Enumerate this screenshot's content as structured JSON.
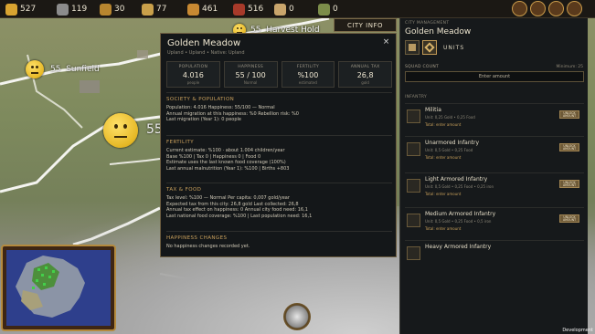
{
  "topbar": {
    "resources": [
      {
        "icon": "gold-coins-icon",
        "value": "527",
        "color": "#d9a431"
      },
      {
        "icon": "iron-ingot-icon",
        "value": "119",
        "color": "#8c8c8c"
      },
      {
        "icon": "food-crate-icon",
        "value": "30",
        "color": "#b8862f"
      },
      {
        "icon": "lumber-icon",
        "value": "77",
        "color": "#c9a04a"
      },
      {
        "icon": "bread-icon",
        "value": "461",
        "color": "#c88932"
      },
      {
        "icon": "wine-icon",
        "value": "516",
        "color": "#a83a2a"
      },
      {
        "icon": "horse-icon",
        "value": "0",
        "color": "#c9a56c"
      },
      {
        "icon": "map-scroll-icon",
        "value": "0",
        "color": "#7c8d4a"
      }
    ]
  },
  "map": {
    "cities": [
      {
        "count": "55",
        "name": "Harvest Hold"
      },
      {
        "count": "55",
        "name": "Sunfield"
      },
      {
        "count": "55",
        "name": ""
      }
    ]
  },
  "city_info_button": "CITY INFO",
  "panel": {
    "title": "Golden Meadow",
    "subtitle": "Upland • Upland • Native: Upland",
    "close": "×",
    "stats": [
      {
        "key": "POPULATION",
        "value": "4.016",
        "note": "people"
      },
      {
        "key": "HAPPINESS",
        "value": "55 / 100",
        "note": "Normal"
      },
      {
        "key": "FERTILITY",
        "value": "%100",
        "note": "estimated"
      },
      {
        "key": "ANNUAL TAX",
        "value": "26,8",
        "note": "gold"
      }
    ],
    "sections": [
      {
        "title": "SOCIETY & POPULATION",
        "lines": [
          "Population: 4.016   Happiness: 55/100 — Normal",
          "Annual migration at this happiness: %0   Rebellion risk: %0",
          "Last migration (Year 1): 0 people"
        ]
      },
      {
        "title": "FERTILITY",
        "lines": [
          "Current estimate: %100  ·  about 1.004 children/year",
          "Base %100  |  Tax 0  |  Happiness 0  |  Food 0",
          "Estimate uses the last known food coverage (100%)",
          "Last annual malnutrition (Year 1): %100  |  Births +803"
        ]
      },
      {
        "title": "TAX & FOOD",
        "lines": [
          "Tax level: %100 — Normal   Per capita: 0,007 gold/year",
          "Expected tax from this city: 26,8 gold   Last collected: 26,8",
          "Annual tax effect on happiness: 0   Annual city food need: 16,1",
          "Last national food coverage: %100  |  Last population need: 16,1"
        ]
      },
      {
        "title": "HAPPINESS CHANGES",
        "lines": [
          "No happiness changes recorded yet."
        ]
      }
    ]
  },
  "right_panel": {
    "heading": "CITY MANAGEMENT",
    "city_name": "Golden Meadow",
    "tab_label": "UNITS",
    "squad_label": "SQUAD COUNT",
    "squad_min": "Minimum: 25",
    "amount_placeholder": "Enter amount",
    "infantry_label": "INFANTRY",
    "units": [
      {
        "name": "Militia",
        "cost": "Unit: 0,25 Gold  •  0,25 Food",
        "total": "Total: enter amount",
        "button": "UNLOCK AMOUNT"
      },
      {
        "name": "Unarmored Infantry",
        "cost": "Unit: 0,5 Gold  •  0,25 Food",
        "total": "Total: enter amount",
        "button": "UNLOCK AMOUNT"
      },
      {
        "name": "Light Armored Infantry",
        "cost": "Unit: 0,5 Gold  •  0,25 Food  •  0,25 iron",
        "total": "Total: enter amount",
        "button": "UNLOCK AMOUNT"
      },
      {
        "name": "Medium Armored Infantry",
        "cost": "Unit: 0,5 Gold  •  0,25 Food  •  0,5 iron",
        "total": "Total: enter amount",
        "button": "UNLOCK AMOUNT"
      },
      {
        "name": "Heavy Armored Infantry",
        "cost": "",
        "total": "",
        "button": ""
      }
    ]
  },
  "footer": {
    "dev_label": "Development"
  }
}
